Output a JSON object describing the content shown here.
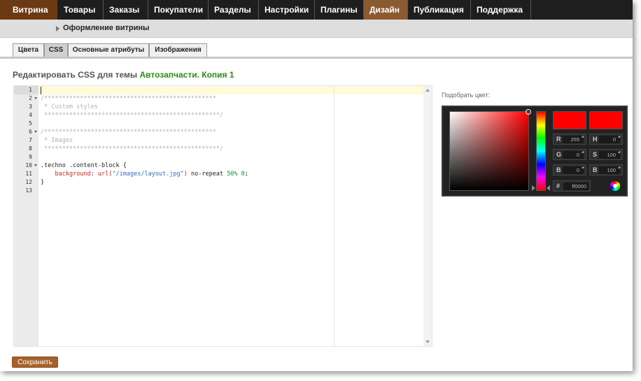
{
  "topnav": {
    "brand": "Витрина",
    "items": [
      {
        "label": "Товары"
      },
      {
        "label": "Заказы"
      },
      {
        "label": "Покупатели"
      },
      {
        "label": "Разделы"
      },
      {
        "label": "Настройки"
      },
      {
        "label": "Плагины"
      },
      {
        "label": "Дизайн",
        "active": true
      },
      {
        "label": "Публикация"
      },
      {
        "label": "Поддержка"
      }
    ],
    "colors": {
      "bar": "#1e1e1e",
      "brand": "#6b3a13",
      "active": "#8a5a30"
    }
  },
  "subnav": {
    "label": "Оформление витрины"
  },
  "tabs": [
    {
      "label": "Цвета"
    },
    {
      "label": "CSS",
      "active": true
    },
    {
      "label": "Основные атрибуты"
    },
    {
      "label": "Изображения"
    }
  ],
  "heading": {
    "prefix": "Редактировать CSS для темы",
    "theme": "Автозапчасти. Копия 1"
  },
  "editor": {
    "lines": [
      "1",
      "2",
      "3",
      "4",
      "5",
      "6",
      "7",
      "8",
      "9",
      "10",
      "11",
      "12",
      "13"
    ],
    "code": {
      "l2": "/************************************************",
      "l3": " * Custom styles",
      "l4": " *************************************************/",
      "l6": "/************************************************",
      "l7": " * Images",
      "l8": " *************************************************/",
      "l10": ".techno .content-block {",
      "l11_indent": "    ",
      "l11_prop": "background",
      "l11_colon": ": ",
      "l11_func_open": "url(",
      "l11_string": "\"/images/layout.jpg\"",
      "l11_func_close": ")",
      "l11_repeat": " no-repeat ",
      "l11_pct": "50%",
      "l11_sp": " ",
      "l11_zero": "0",
      "l11_semi": ";",
      "l12": "}"
    }
  },
  "picker": {
    "label": "Подобрать цвет:",
    "current_color": "#ff0000",
    "fields": {
      "R": {
        "label": "R",
        "value": "255"
      },
      "G": {
        "label": "G",
        "value": "0"
      },
      "B": {
        "label": "B",
        "value": "0"
      },
      "H": {
        "label": "H",
        "value": "0"
      },
      "S": {
        "label": "S",
        "value": "100"
      },
      "Bv": {
        "label": "B",
        "value": "100"
      }
    },
    "hex": {
      "label": "#",
      "value": "ff0000"
    }
  },
  "save_button": "Сохранить"
}
